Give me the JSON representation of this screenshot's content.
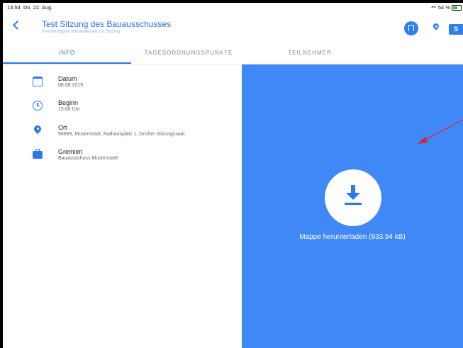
{
  "status_bar": {
    "time": "13:54",
    "date": "Do. 22. Aug.",
    "battery": "54 %"
  },
  "header": {
    "title": "Test Sitzung des Bauausschusses",
    "subtitle": "Ihre benötigten Informationen zur Sitzung",
    "folder_label": "S"
  },
  "tabs": [
    {
      "label": "INFO",
      "active": true
    },
    {
      "label": "TAGESORDNUNGSPUNKTE",
      "active": false
    },
    {
      "label": "TEILNEHMER",
      "active": false
    }
  ],
  "info": [
    {
      "icon": "calendar-icon",
      "label": "Datum",
      "value": "08.08.2019"
    },
    {
      "icon": "clock-icon",
      "label": "Beginn",
      "value": "15:00 Uhr"
    },
    {
      "icon": "location-pin-icon",
      "label": "Ort",
      "value": "56999, Musterstadt, Rathausplatz 1, Großer Sitzungssaal"
    },
    {
      "icon": "briefcase-icon",
      "label": "Gremien",
      "value": "Bauausschuss Musterstadt"
    }
  ],
  "download": {
    "label": "Mappe herunterladen (833.94 kB)",
    "icon": "download-icon"
  },
  "colors": {
    "accent": "#2a79f1",
    "panel": "#3f88f6",
    "annotation": "#e0202a"
  }
}
